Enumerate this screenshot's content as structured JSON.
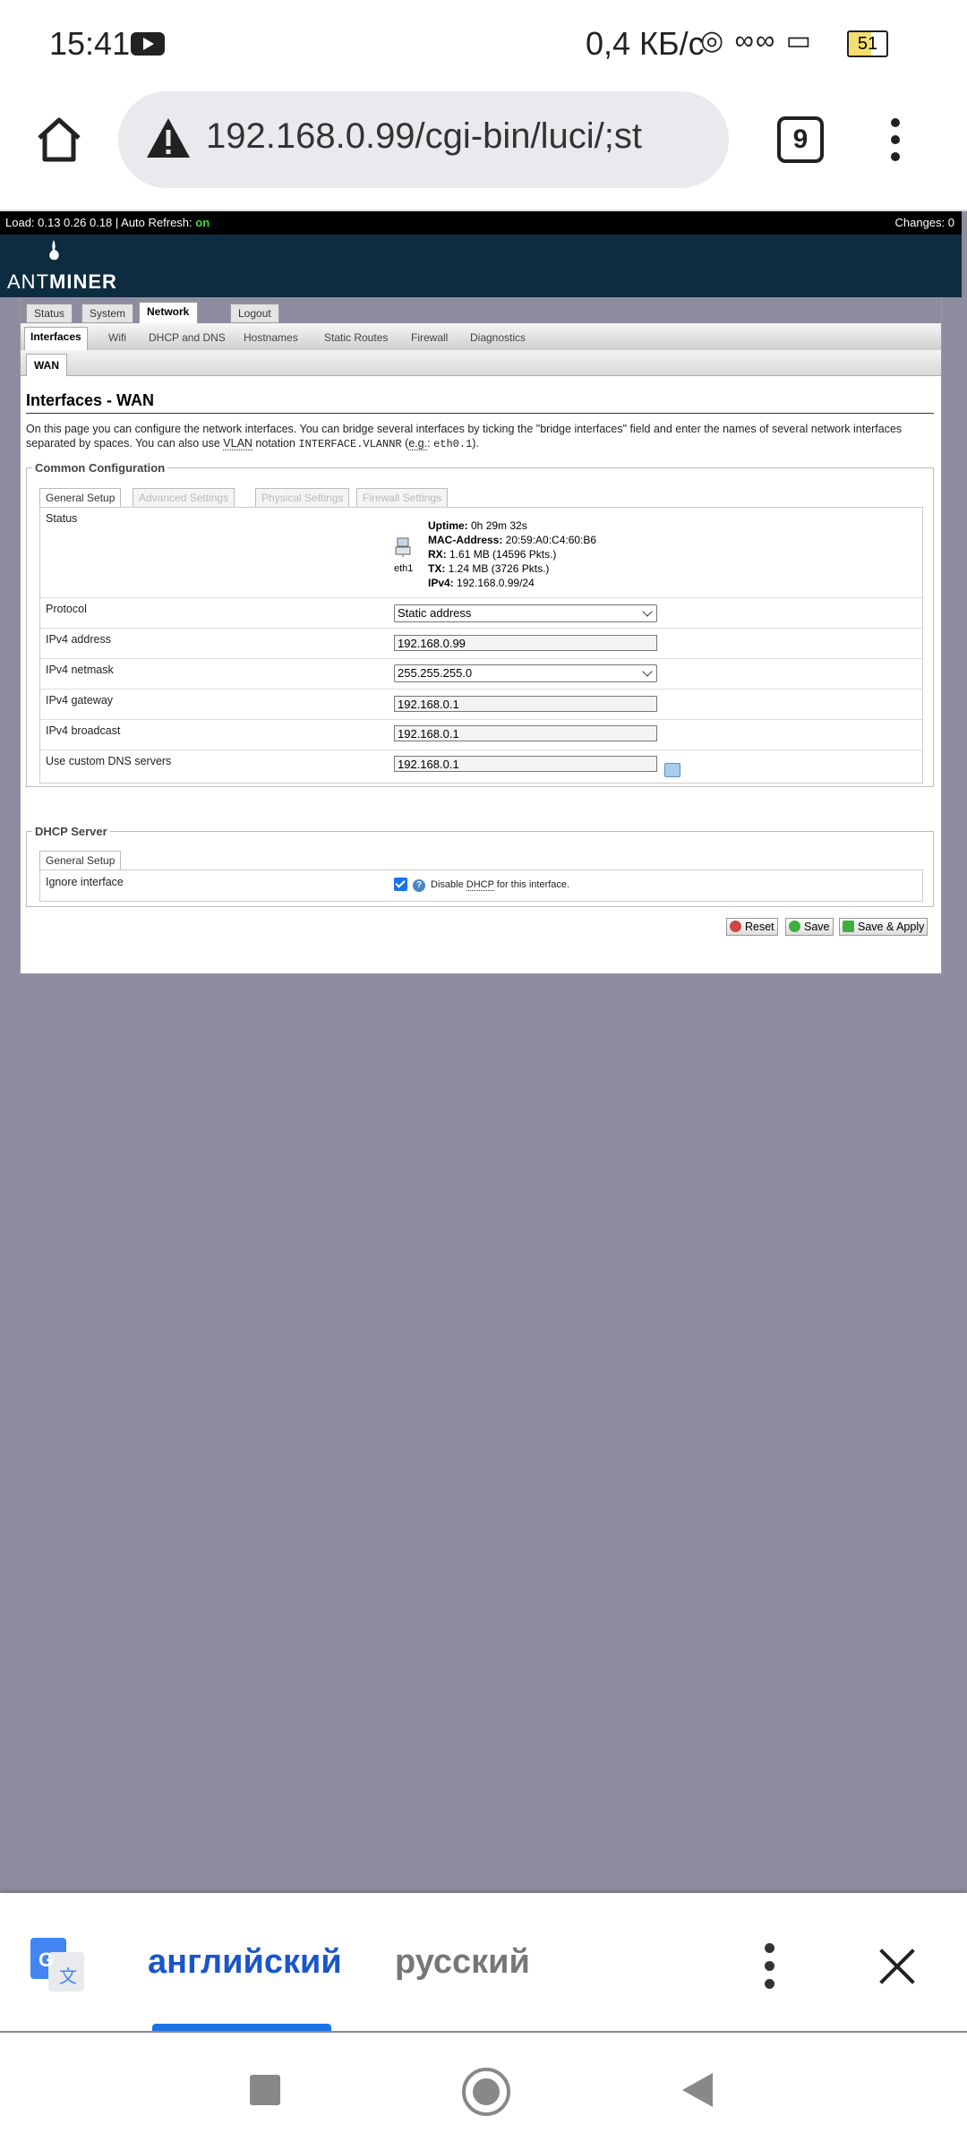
{
  "statusbar": {
    "time": "15:41",
    "speed": "0,4 КБ/с",
    "battery": "51"
  },
  "browser": {
    "url": "192.168.0.99/cgi-bin/luci/;st",
    "tab_count": "9"
  },
  "luci": {
    "loadbar_prefix": "Load: 0.13 0.26 0.18 | Auto Refresh: ",
    "loadbar_on": "on",
    "changes": "Changes: 0",
    "logo_ant": "ANT",
    "logo_miner": "MINER",
    "main_tabs": [
      "Status",
      "System",
      "Network",
      "Logout"
    ],
    "sub_tabs": [
      "Interfaces",
      "Wifi",
      "DHCP and DNS",
      "Hostnames",
      "Static Routes",
      "Firewall",
      "Diagnostics"
    ],
    "wan_tab": "WAN",
    "title": "Interfaces - WAN",
    "desc_1": "On this page you can configure the network interfaces. You can bridge several interfaces by ticking the \"bridge interfaces\" field and enter the names of several network interfaces separated by spaces. You can also use ",
    "desc_vlan": "VLAN",
    "desc_2": " notation ",
    "desc_code": "INTERFACE.VLANNR",
    "desc_3": " (",
    "desc_eg": "e.g.",
    "desc_4": ": ",
    "desc_code2": "eth0.1",
    "desc_5": ").",
    "common": {
      "legend": "Common Configuration",
      "tabs": [
        "General Setup",
        "Advanced Settings",
        "Physical Settings",
        "Firewall Settings"
      ],
      "status_label": "Status",
      "iface": "eth1",
      "uptime_k": "Uptime:",
      "uptime_v": " 0h 29m 32s",
      "mac_k": "MAC-Address:",
      "mac_v": " 20:59:A0:C4:60:B6",
      "rx_k": "RX:",
      "rx_v": " 1.61 MB (14596 Pkts.)",
      "tx_k": "TX:",
      "tx_v": " 1.24 MB (3726 Pkts.)",
      "ipv4_k": "IPv4:",
      "ipv4_v": " 192.168.0.99/24",
      "rows": [
        {
          "label": "Protocol",
          "value": "Static address"
        },
        {
          "label": "IPv4 address",
          "value": "192.168.0.99"
        },
        {
          "label": "IPv4 netmask",
          "value": "255.255.255.0"
        },
        {
          "label": "IPv4 gateway",
          "value": "192.168.0.1"
        },
        {
          "label": "IPv4 broadcast",
          "value": "192.168.0.1"
        },
        {
          "label": "Use custom DNS servers",
          "value": "192.168.0.1"
        }
      ]
    },
    "dhcp": {
      "legend": "DHCP Server",
      "tab": "General Setup",
      "ignore_label": "Ignore interface",
      "text_1": "Disable ",
      "text_dhcp": "DHCP",
      "text_2": " for this interface."
    },
    "buttons": {
      "reset": "Reset",
      "save": "Save",
      "save_apply": "Save & Apply"
    }
  },
  "translate": {
    "lang_from": "английский",
    "lang_to": "русский"
  }
}
